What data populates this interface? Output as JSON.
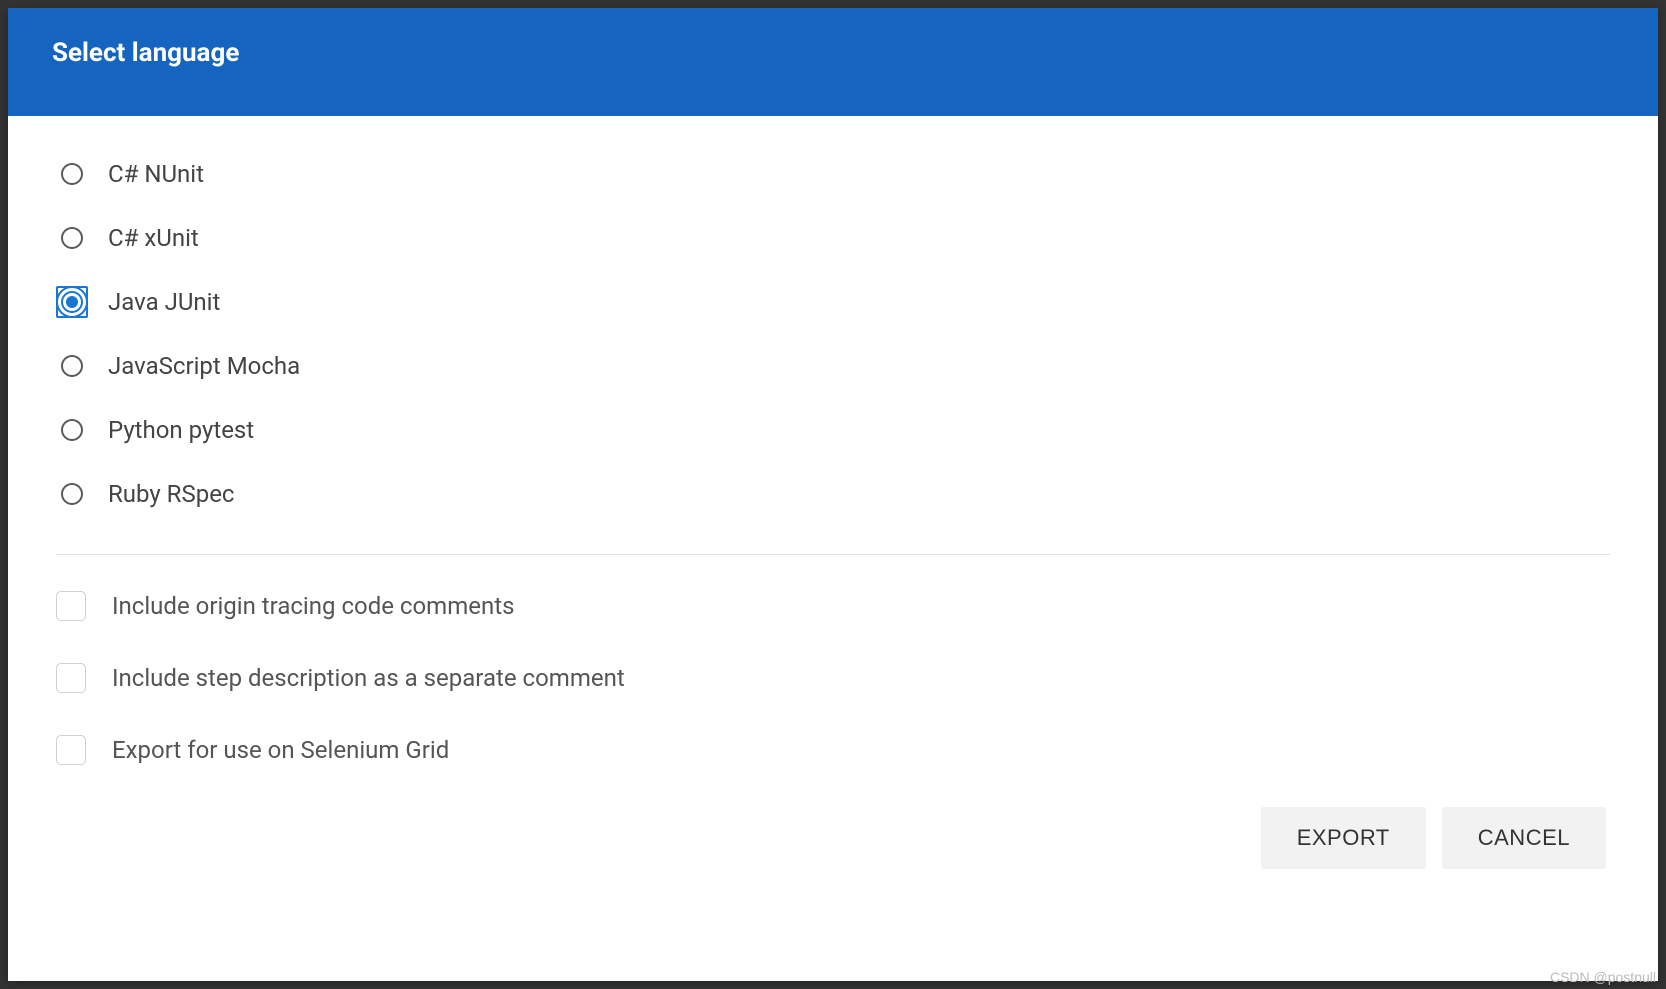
{
  "dialog": {
    "title": "Select language"
  },
  "languages": [
    {
      "label": "C# NUnit",
      "selected": false
    },
    {
      "label": "C# xUnit",
      "selected": false
    },
    {
      "label": "Java JUnit",
      "selected": true
    },
    {
      "label": "JavaScript Mocha",
      "selected": false
    },
    {
      "label": "Python pytest",
      "selected": false
    },
    {
      "label": "Ruby RSpec",
      "selected": false
    }
  ],
  "options": [
    {
      "label": "Include origin tracing code comments",
      "checked": false
    },
    {
      "label": "Include step description as a separate comment",
      "checked": false
    },
    {
      "label": "Export for use on Selenium Grid",
      "checked": false
    }
  ],
  "buttons": {
    "export": "EXPORT",
    "cancel": "CANCEL"
  },
  "watermark": "CSDN @postnull"
}
